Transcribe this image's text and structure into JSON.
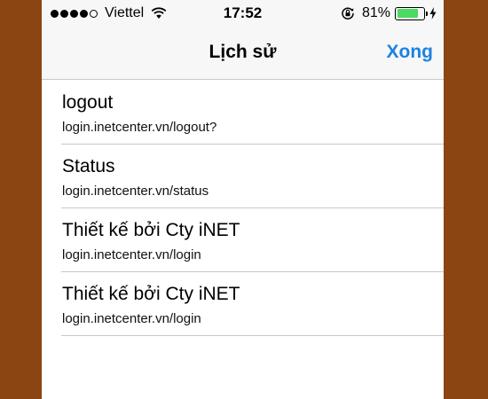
{
  "status_bar": {
    "carrier": "Viettel",
    "time": "17:52",
    "battery_percent": "81%",
    "battery_level": 0.81,
    "signal_bars_filled": 4,
    "signal_bars_total": 5
  },
  "nav": {
    "title": "Lịch sử",
    "done_label": "Xong"
  },
  "history": [
    {
      "title": "logout",
      "url": "login.inetcenter.vn/logout?"
    },
    {
      "title": "Status",
      "url": "login.inetcenter.vn/status"
    },
    {
      "title": "Thiết kế bởi Cty iNET",
      "url": "login.inetcenter.vn/login"
    },
    {
      "title": "Thiết kế bởi Cty iNET",
      "url": "login.inetcenter.vn/login"
    }
  ],
  "colors": {
    "accent": "#1a82e2",
    "battery": "#4cd964",
    "background": "#8a4513"
  }
}
